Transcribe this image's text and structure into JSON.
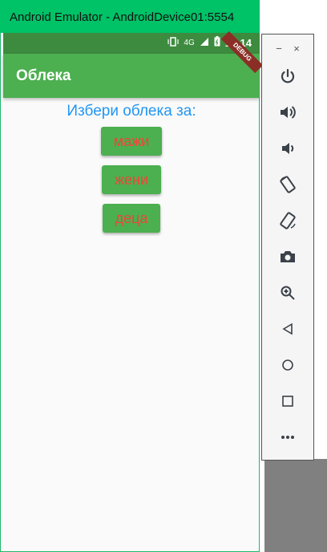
{
  "window": {
    "title": "Android Emulator - AndroidDevice01:5554"
  },
  "status_bar": {
    "time": "10:14",
    "network": "4G"
  },
  "debug_banner": "DEBUG",
  "app_bar": {
    "title": "Облека"
  },
  "main": {
    "prompt": "Избери облека за:",
    "buttons": [
      {
        "label": "мажи"
      },
      {
        "label": "жени"
      },
      {
        "label": "деца"
      }
    ]
  },
  "sidebar": {
    "top": {
      "minimize": "−",
      "close": "×"
    },
    "controls": [
      {
        "icon": "power-icon"
      },
      {
        "icon": "volume-up-icon"
      },
      {
        "icon": "volume-down-icon"
      },
      {
        "icon": "rotate-left-icon"
      },
      {
        "icon": "rotate-right-icon"
      },
      {
        "icon": "camera-icon"
      },
      {
        "icon": "zoom-icon"
      },
      {
        "icon": "back-icon"
      },
      {
        "icon": "home-icon"
      },
      {
        "icon": "overview-icon"
      },
      {
        "icon": "more-icon"
      }
    ]
  },
  "colors": {
    "title_bar": "#00c267",
    "status_bar": "#3d8b3f",
    "app_bar": "#4caf50",
    "prompt": "#2196f3",
    "button_text": "#f44336"
  }
}
